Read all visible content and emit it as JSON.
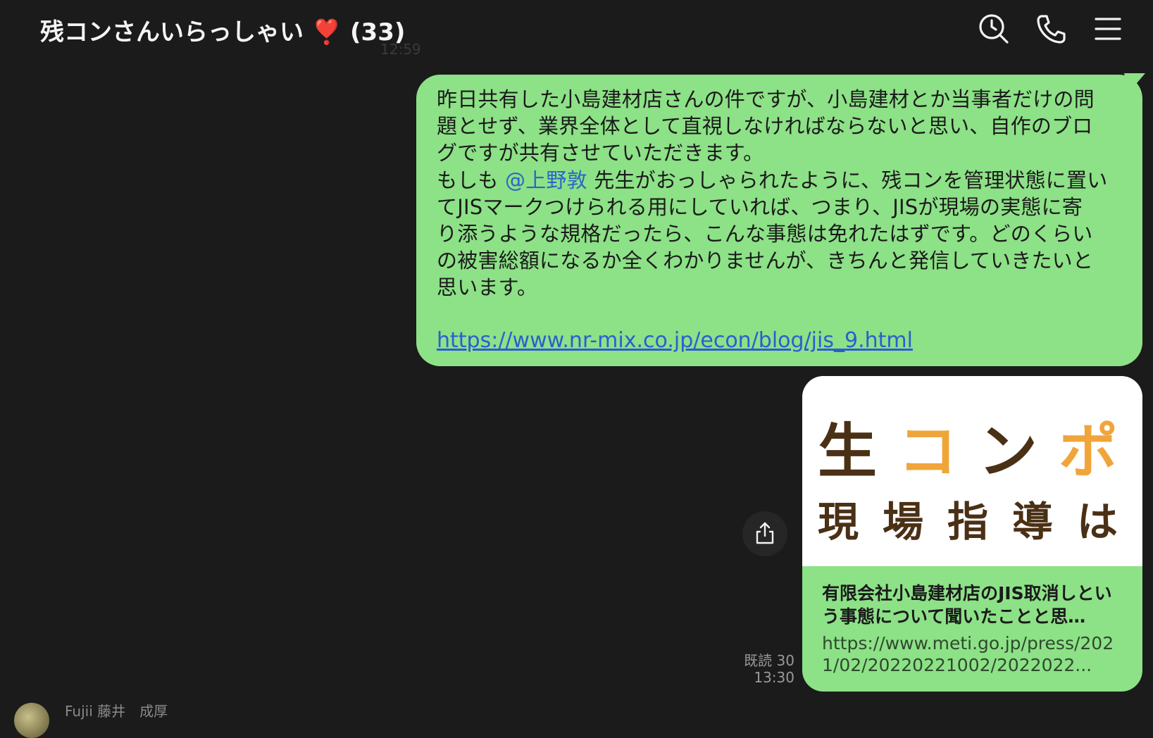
{
  "header": {
    "title": "残コンさんいらっしゃい ❣️ (33)",
    "ghost_time": "12:59",
    "icons": [
      "search-clock-icon",
      "phone-icon",
      "menu-icon"
    ]
  },
  "message": {
    "text_lines": [
      "昨日共有した小島建材店さんの件ですが、小島建材とか当事者だけの問",
      "題とせず、業界全体として直視しなければならないと思い、自作のブロ",
      "グですが共有させていただきます。"
    ],
    "line4_prefix": "もしも ",
    "mention": "@上野敦",
    "line4_suffix": " 先生がおっしゃられたように、残コンを管理状態に置い",
    "text_lines_after": [
      "てJISマークつけられる用にしていれば、つまり、JISが現場の実態に寄",
      "り添うような規格だったら、こんな事態は免れたはずです。どのくらい",
      "の被害総額になるか全くわかりませんが、きちんと発信していきたいと",
      "思います。"
    ],
    "link": "https://www.nr-mix.co.jp/econ/blog/jis_9.html"
  },
  "preview": {
    "banner_c1": "生",
    "banner_c2": "コ",
    "banner_c3": "ン",
    "banner_c4": "ポ",
    "banner_row2": "現場指導は無",
    "title": "有限会社小島建材店のJIS取消しという事態について聞いたことと思…",
    "url": "https://www.meti.go.jp/press/2021/02/20220221002/2022022..."
  },
  "receipt": {
    "read": "既読 30",
    "time": "13:30"
  },
  "next_sender": {
    "name": "Fujii 藤井　成厚"
  },
  "colors": {
    "background": "#1b1b1b",
    "bubble": "#8de187",
    "link": "#2a5fd0",
    "mention": "#2a66c8",
    "banner_brown": "#4a3015",
    "banner_orange": "#f0a53a"
  }
}
